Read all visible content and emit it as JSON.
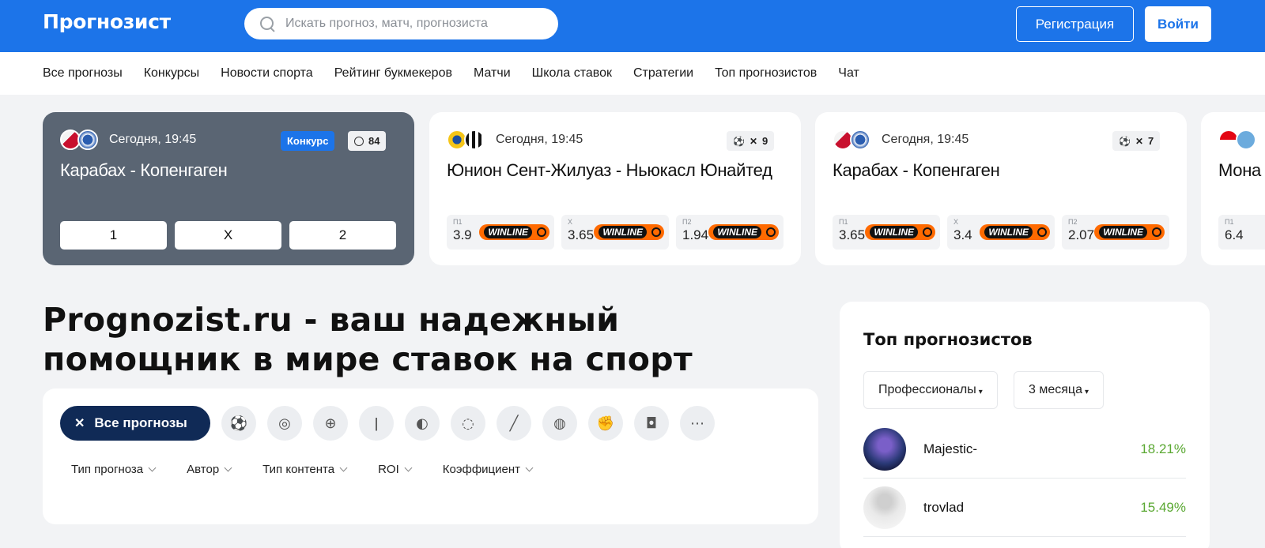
{
  "header": {
    "logo": "Прогнозист",
    "search_placeholder": "Искать прогноз, матч, прогнозиста",
    "register_label": "Регистрация",
    "login_label": "Войти"
  },
  "nav": {
    "items": [
      "Все прогнозы",
      "Конкурсы",
      "Новости спорта",
      "Рейтинг букмекеров",
      "Матчи",
      "Школа ставок",
      "Стратегии",
      "Топ прогнозистов",
      "Чат"
    ]
  },
  "cards": [
    {
      "time": "Сегодня, 19:45",
      "title": "Карабах - Копенгаген",
      "badge": "Конкурс",
      "count": "84",
      "outcomes": [
        "1",
        "X",
        "2"
      ]
    },
    {
      "time": "Сегодня, 19:45",
      "title": "Юнион Сент-Жилуаз - Ньюкасл Юнайтед",
      "count": "9",
      "odds": [
        {
          "label": "П1",
          "value": "3.9",
          "bookmaker": "WINLINE"
        },
        {
          "label": "Х",
          "value": "3.65",
          "bookmaker": "WINLINE"
        },
        {
          "label": "П2",
          "value": "1.94",
          "bookmaker": "WINLINE"
        }
      ]
    },
    {
      "time": "Сегодня, 19:45",
      "title": "Карабах - Копенгаген",
      "count": "7",
      "odds": [
        {
          "label": "П1",
          "value": "3.65",
          "bookmaker": "WINLINE"
        },
        {
          "label": "Х",
          "value": "3.4",
          "bookmaker": "WINLINE"
        },
        {
          "label": "П2",
          "value": "2.07",
          "bookmaker": "WINLINE"
        }
      ]
    },
    {
      "title": "Мона",
      "odds": [
        {
          "label": "П1",
          "value": "6.4"
        }
      ]
    }
  ],
  "hero": {
    "title": "Prognozist.ru - ваш надежный помощник в мире ставок на спорт"
  },
  "filter_panel": {
    "all_label": "Все прогнозы",
    "sports": [
      "football-icon",
      "basketball-icon",
      "hockey-icon",
      "tennis-icon",
      "table-tennis-icon",
      "baseball-icon",
      "volleyball-icon",
      "mma-icon",
      "boxing-icon",
      "more-icon"
    ],
    "filters": [
      "Тип прогноза",
      "Автор",
      "Тип контента",
      "ROI",
      "Коэффициент"
    ]
  },
  "top_forecasters": {
    "title": "Топ прогнозистов",
    "category": "Профессионалы",
    "period": "3 месяца",
    "users": [
      {
        "name": "Majestic-",
        "roi": "18.21%"
      },
      {
        "name": "trovlad",
        "roi": "15.49%"
      }
    ]
  },
  "colors": {
    "brand": "#1c74e9",
    "dark_card": "#5a6573",
    "navy": "#102a56",
    "roi_green": "#5aa832",
    "winline_orange": "#ff6a00"
  }
}
